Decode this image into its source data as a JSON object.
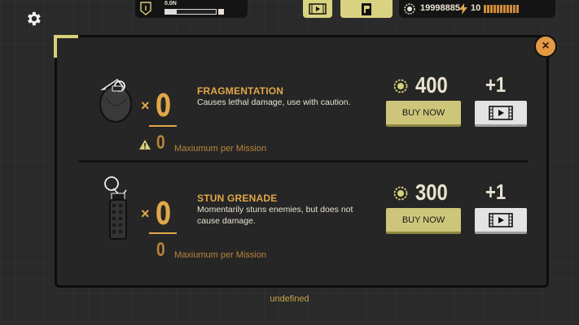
{
  "hud": {
    "rank_label": "0.0N",
    "xp_fraction": 0.22,
    "coins": "19998885",
    "energy": "10",
    "energy_segments": 11
  },
  "items": [
    {
      "name": "FRAGMENTATION",
      "description": "Causes lethal damage, use with caution.",
      "count": "0",
      "max_count": "0",
      "max_label": "Maxiumum per Mission",
      "price": "400",
      "buy_label": "BUY NOW",
      "ad_reward": "+1",
      "icon": "frag-grenade-icon"
    },
    {
      "name": "STUN GRENADE",
      "description": "Momentarily stuns enemies, but does not cause damage.",
      "count": "0",
      "max_count": "0",
      "max_label": "Maxiumum per Mission",
      "price": "300",
      "buy_label": "BUY NOW",
      "ad_reward": "+1",
      "icon": "stun-grenade-icon"
    }
  ],
  "times_symbol": "×",
  "close_symbol": "×",
  "footer": "undefined",
  "colors": {
    "accent": "#e2a748",
    "button": "#cdc57a",
    "panel": "#262626"
  }
}
